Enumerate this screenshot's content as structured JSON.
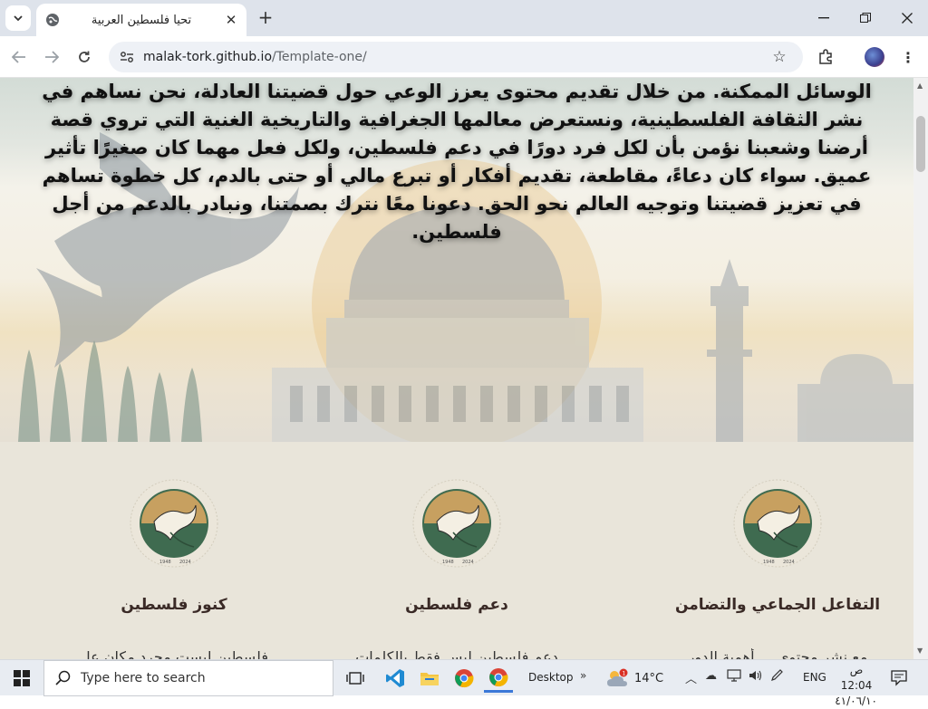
{
  "browser": {
    "tab_title": "تحيا فلسطين العربية",
    "url_host": "malak-tork.github.io",
    "url_path": "/Template-one/"
  },
  "hero": {
    "lines": [
      "الوسائل الممكنة. من خلال تقديم محتوى يعزز الوعي حول قضيتنا العادلة، نحن نساهم في",
      "نشر الثقافة الفلسطينية، ونستعرض معالمها الجغرافية والتاريخية الغنية التي تروي قصة",
      "أرضنا وشعبنا نؤمن بأن لكل فرد دورًا في دعم فلسطين، ولكل فعل مهما كان صغيرًا تأثير",
      "عميق. سواء كان دعاءً، مقاطعة، تقديم أفكار أو تبرع مالي أو حتى بالدم، كل خطوة تساهم",
      "في تعزيز قضيتنا وتوجيه العالم نحو الحق. دعونا معًا نترك بصمتنا، ونبادر بالدعم من أجل",
      "فلسطين."
    ]
  },
  "cards": [
    {
      "title": "التفاعل الجماعي والتضامن",
      "text": "مع نشر محتوى ... أهمية الدور",
      "emblem_years": [
        "1948",
        "2024"
      ]
    },
    {
      "title": "دعم فلسطين",
      "text": "دعم فلسطين ليس فقط بالكلمات",
      "emblem_years": [
        "1948",
        "2024"
      ]
    },
    {
      "title": "كنوز فلسطين",
      "text": "فلسطين ليست مجرد مكان عل",
      "emblem_years": [
        "1948",
        "2024"
      ]
    }
  ],
  "taskbar": {
    "search_placeholder": "Type here to search",
    "desktop_label": "Desktop",
    "temperature": "14°C",
    "language": "ENG",
    "time": "ص 12:04",
    "date": "٤١/٠٦/١٠",
    "weather_badge": "1"
  },
  "colors": {
    "page_bg": "#e9e5da",
    "card_title": "#3a2a26",
    "taskbar": "#e8ecf2"
  }
}
